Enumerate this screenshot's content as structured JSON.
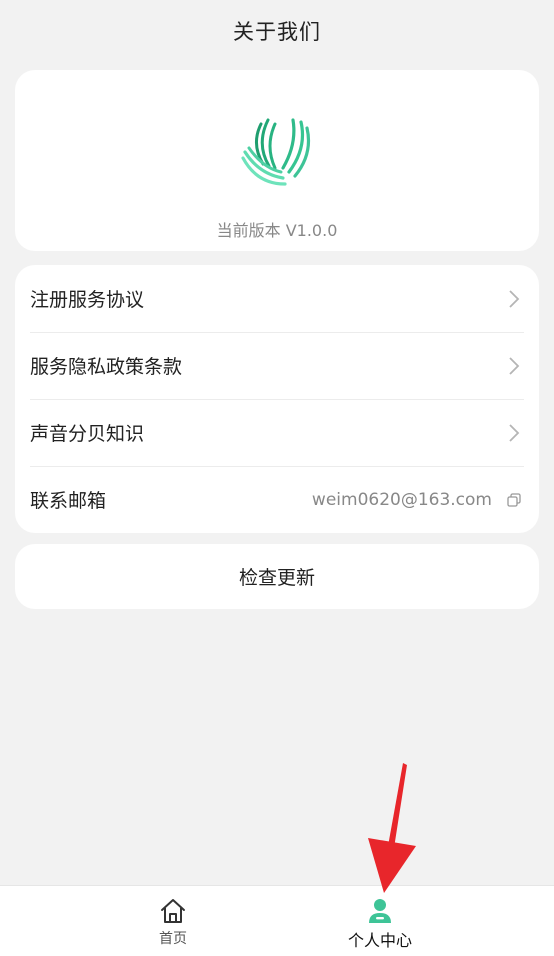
{
  "header": {
    "title": "关于我们"
  },
  "about": {
    "version_text": "当前版本 V1.0.0",
    "logo_icon": "wave-leaf-logo"
  },
  "menu": {
    "items": [
      {
        "label": "注册服务协议",
        "icon": "chevron-right-icon"
      },
      {
        "label": "服务隐私政策条款",
        "icon": "chevron-right-icon"
      },
      {
        "label": "声音分贝知识",
        "icon": "chevron-right-icon"
      },
      {
        "label": "联系邮箱",
        "value": "weim0620@163.com",
        "icon": "copy-icon"
      }
    ]
  },
  "update": {
    "label": "检查更新"
  },
  "tabbar": {
    "tabs": [
      {
        "label": "首页",
        "icon": "home-icon",
        "active": false
      },
      {
        "label": "个人中心",
        "icon": "person-icon",
        "active": true
      }
    ]
  },
  "colors": {
    "background": "#f2f2f2",
    "card": "#ffffff",
    "accent": "#3ec497",
    "annotation_arrow": "#e8262b"
  }
}
